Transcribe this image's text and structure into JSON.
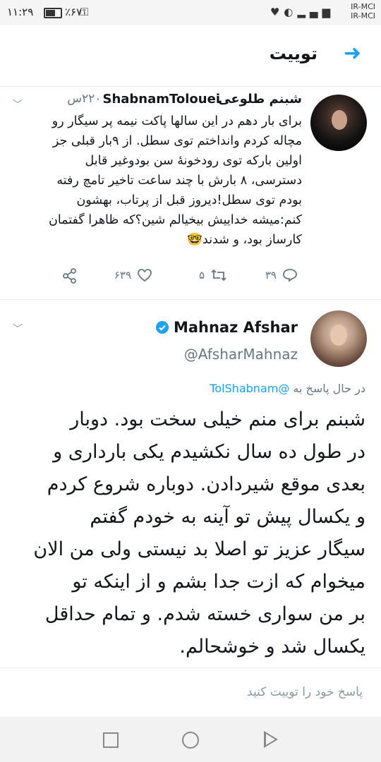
{
  "status_bar": {
    "time": "۱۱:۲۹",
    "battery": "٪۶۷",
    "carrier_1": "IR-MCI",
    "carrier_2": "IR-MCI",
    "battery_level": 0.67
  },
  "header": {
    "title": "توییت"
  },
  "tweet1": {
    "name": "شبنم طلوعی",
    "handle": "ShabnamTolouei",
    "time": "... ۲۲۰س",
    "lines": [
      "برای بار دهم در این سالها پاکت نیمه پر سیگار رو",
      "مچاله کردم وانداختم توی سطل. از ۹بار قبلی جز",
      "اولین بارکه توی رودخونهٔ سن بودوغیر قابل",
      "دسترسی، ۸ بارش با چند ساعت تاخیر تامچ رفته",
      "بودم توی سطل!دیروز قبل از پرتاب، بهشون",
      "کنم:میشه خداییش بیخیالم شین؟که ظاهرا گفتمان",
      "کارساز بود، و شدند🤓"
    ],
    "actions": {
      "reply_count": "۳۹",
      "retweet_count": "۵",
      "like_count": "۶۳۹"
    }
  },
  "tweet2": {
    "name": "Mahnaz Afshar",
    "handle": "@AfsharMahnaz",
    "reply_prefix": "در حال پاسخ به",
    "reply_mention": "@TolShabnam",
    "lines": [
      "شبنم برای منم خیلی سخت بود. دوبار",
      "در طول ده سال نکشیدم یکی بارداری و",
      "بعدی موقع شیردادن. دوباره شروع کردم",
      "و یکسال پیش تو آینه به خودم گفتم",
      "سیگار عزیز تو اصلا بد نیستی ولی من الان",
      "میخوام که ازت جدا بشم و از اینکه تو",
      "بر من سواری خسته شدم. و تمام حداقل",
      "یکسال شد و خوشحالم."
    ]
  },
  "reply_bar": {
    "placeholder": "پاسخ خود را توییت کنید"
  },
  "colors": {
    "accent": "#1da1f2",
    "muted": "#657786",
    "text": "#14171a"
  }
}
